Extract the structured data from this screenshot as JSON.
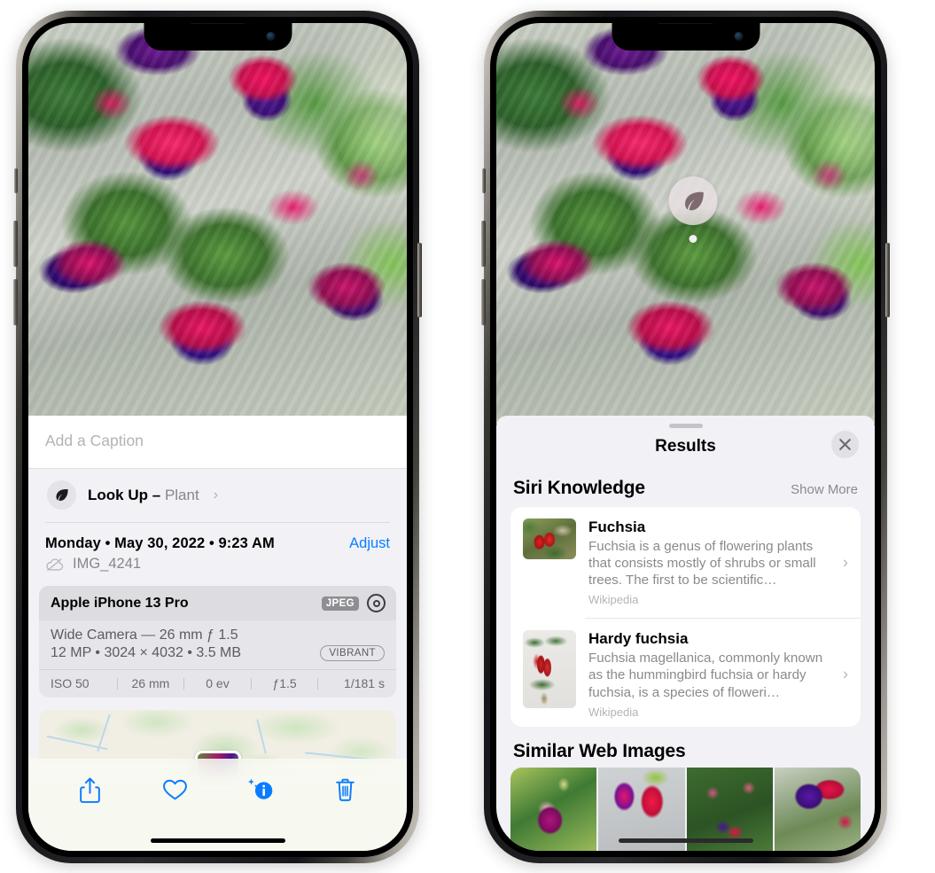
{
  "left_phone": {
    "caption": {
      "placeholder": "Add a Caption",
      "value": ""
    },
    "lookup": {
      "label": "Look Up",
      "dash": "–",
      "subject": "Plant",
      "chevron": "›",
      "icon": "leaf-icon"
    },
    "meta": {
      "date": "Monday • May 30, 2022 • 9:23 AM",
      "adjust_label": "Adjust",
      "file_name": "IMG_4241",
      "cloud_icon": "icloud-slash-icon"
    },
    "exif": {
      "device": "Apple iPhone 13 Pro",
      "format_badge": "JPEG",
      "lens_line": "Wide Camera — 26 mm ƒ 1.5",
      "size_line": "12 MP • 3024 × 4032 • 3.5 MB",
      "style_badge": "VIBRANT",
      "stats": [
        "ISO 50",
        "26 mm",
        "0 ev",
        "ƒ1.5",
        "1/181 s"
      ]
    },
    "toolbar": [
      {
        "name": "share-button",
        "icon": "share-icon"
      },
      {
        "name": "favorite-button",
        "icon": "heart-icon"
      },
      {
        "name": "info-button",
        "icon": "info-sparkle-icon"
      },
      {
        "name": "delete-button",
        "icon": "trash-icon"
      }
    ],
    "accent_color": "#0a7cff"
  },
  "right_phone": {
    "visual_lookup_badge": {
      "icon": "leaf-icon"
    },
    "sheet": {
      "title": "Results",
      "close_icon": "close-icon",
      "grabber": "drag-handle"
    },
    "siri_knowledge": {
      "title": "Siri Knowledge",
      "show_more": "Show More",
      "items": [
        {
          "title": "Fuchsia",
          "description": "Fuchsia is a genus of flowering plants that consists mostly of shrubs or small trees. The first to be scientific…",
          "source": "Wikipedia",
          "chevron": "›"
        },
        {
          "title": "Hardy fuchsia",
          "description": "Fuchsia magellanica, commonly known as the hummingbird fuchsia or hardy fuchsia, is a species of floweri…",
          "source": "Wikipedia",
          "chevron": "›"
        }
      ]
    },
    "similar_web_images": {
      "title": "Similar Web Images",
      "count": 4
    }
  }
}
